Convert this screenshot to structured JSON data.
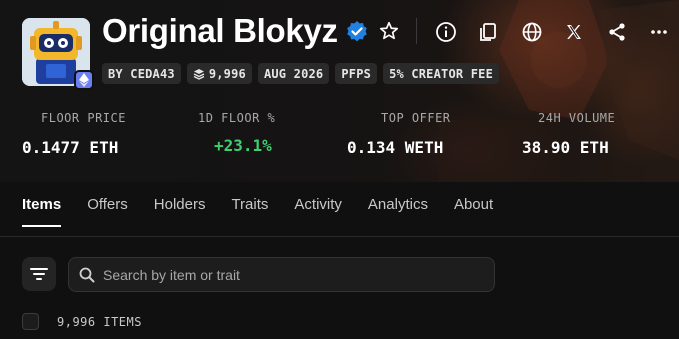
{
  "collection": {
    "title": "Original Blokyz",
    "verified_icon": "verified-check-icon",
    "favorite_icon": "star-outline-icon"
  },
  "header_actions": [
    {
      "name": "info-icon"
    },
    {
      "name": "copy-icon"
    },
    {
      "name": "globe-icon"
    },
    {
      "name": "x-logo-icon"
    },
    {
      "name": "share-icon"
    },
    {
      "name": "more-icon"
    }
  ],
  "badges": {
    "creator": "BY CEDA43",
    "supply": "9,996",
    "date": "AUG 2026",
    "category": "PFPS",
    "fee": "5% CREATOR FEE"
  },
  "stats": {
    "floor_price": {
      "label": "FLOOR PRICE",
      "value": "0.1477 ETH"
    },
    "floor_change": {
      "label": "1D FLOOR %",
      "value": "+23.1%"
    },
    "top_offer": {
      "label": "TOP OFFER",
      "value": "0.134 WETH"
    },
    "volume": {
      "label": "24H VOLUME",
      "value": "38.90 ETH"
    }
  },
  "tabs": [
    {
      "label": "Items",
      "active": true
    },
    {
      "label": "Offers"
    },
    {
      "label": "Holders"
    },
    {
      "label": "Traits"
    },
    {
      "label": "Activity"
    },
    {
      "label": "Analytics"
    },
    {
      "label": "About"
    }
  ],
  "search": {
    "placeholder": "Search by item or trait",
    "value": ""
  },
  "items_count": "9,996 ITEMS",
  "colors": {
    "background": "#101010",
    "positive": "#3ecf6e",
    "verified": "#2081e2",
    "eth_badge": "#6b7ff0"
  }
}
